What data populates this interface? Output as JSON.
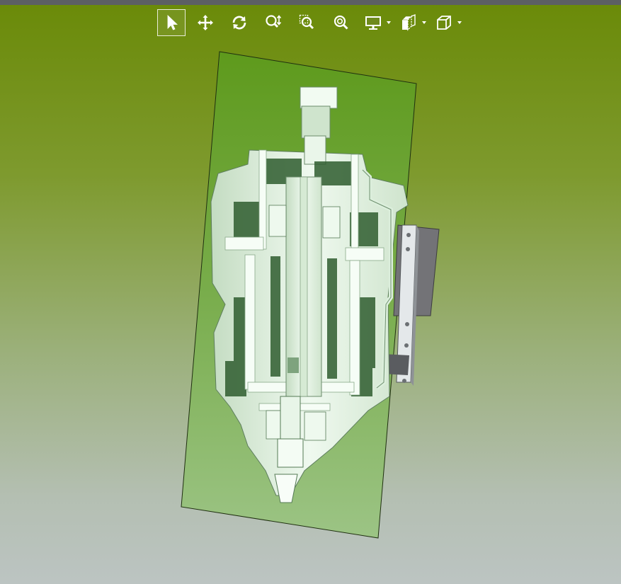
{
  "toolbar": {
    "tools": [
      {
        "id": "select",
        "icon": "select-arrow-icon",
        "active": true
      },
      {
        "id": "pan",
        "icon": "pan-move-icon",
        "active": false
      },
      {
        "id": "rotate",
        "icon": "rotate-icon",
        "active": false
      },
      {
        "id": "zoom",
        "icon": "zoom-icon",
        "active": false
      },
      {
        "id": "zoom-window",
        "icon": "zoom-window-icon",
        "active": false
      },
      {
        "id": "zoom-fit",
        "icon": "zoom-fit-icon",
        "active": false
      },
      {
        "id": "display-mode",
        "icon": "monitor-icon",
        "dropdown": true
      },
      {
        "id": "section-plane",
        "icon": "section-plane-icon",
        "dropdown": true
      },
      {
        "id": "view-cube",
        "icon": "view-cube-icon",
        "dropdown": true
      }
    ]
  },
  "viewport": {
    "model": "sectioned-spindle-assembly",
    "section_plane_color": "#6a9e2a",
    "part_color": "#e6f4e6"
  }
}
